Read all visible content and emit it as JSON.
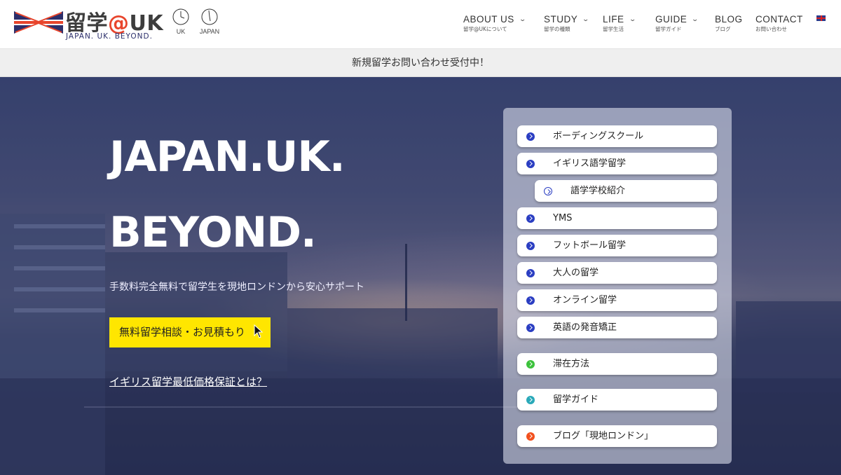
{
  "brand": {
    "title_main": "留学",
    "title_at": "@",
    "title_uk": "UK",
    "subtitle": "JAPAN. UK. BEYOND."
  },
  "clocks": [
    {
      "label": "UK"
    },
    {
      "label": "JAPAN"
    }
  ],
  "nav": {
    "items": [
      {
        "label": "ABOUT US",
        "sub": "留学@UKについて",
        "dropdown": true
      },
      {
        "label": "STUDY",
        "sub": "留学の種類",
        "dropdown": true
      },
      {
        "label": "LIFE",
        "sub": "留学生活",
        "dropdown": true
      },
      {
        "label": "GUIDE",
        "sub": "留学ガイド",
        "dropdown": true
      },
      {
        "label": "BLOG",
        "sub": "ブログ",
        "dropdown": false
      },
      {
        "label": "CONTACT",
        "sub": "お問い合わせ",
        "dropdown": false
      }
    ]
  },
  "notice": "新規留学お問い合わせ受付中！",
  "hero": {
    "title_line1": "JAPAN.UK.",
    "title_line2": "BEYOND.",
    "tagline": "手数料完全無料で留学生を現地ロンドンから安心サポート",
    "cta_label": "無料留学相談・お見積もり",
    "link_label": "イギリス留学最低価格保証とは？"
  },
  "side_menu": [
    {
      "label": "ボーディングスクール",
      "color": "#2b3ec2",
      "style": "filled"
    },
    {
      "label": "イギリス語学留学",
      "color": "#2b3ec2",
      "style": "filled"
    },
    {
      "label": "語学学校紹介",
      "color": "#2b3ec2",
      "style": "outline"
    },
    {
      "label": "YMS",
      "color": "#2b3ec2",
      "style": "filled"
    },
    {
      "label": "フットボール留学",
      "color": "#2b3ec2",
      "style": "filled"
    },
    {
      "label": "大人の留学",
      "color": "#2b3ec2",
      "style": "filled"
    },
    {
      "label": "オンライン留学",
      "color": "#2b3ec2",
      "style": "filled"
    },
    {
      "label": "英語の発音矯正",
      "color": "#2b3ec2",
      "style": "filled"
    },
    {
      "label": "滞在方法",
      "color": "#3cc23c",
      "style": "filled"
    },
    {
      "label": "留学ガイド",
      "color": "#2aa9b9",
      "style": "filled"
    },
    {
      "label": "ブログ「現地ロンドン」",
      "color": "#f2501e",
      "style": "filled"
    }
  ],
  "colors": {
    "brand_navy": "#2c2f6b",
    "brand_red": "#e8452c",
    "cta_yellow": "#ffe600"
  }
}
